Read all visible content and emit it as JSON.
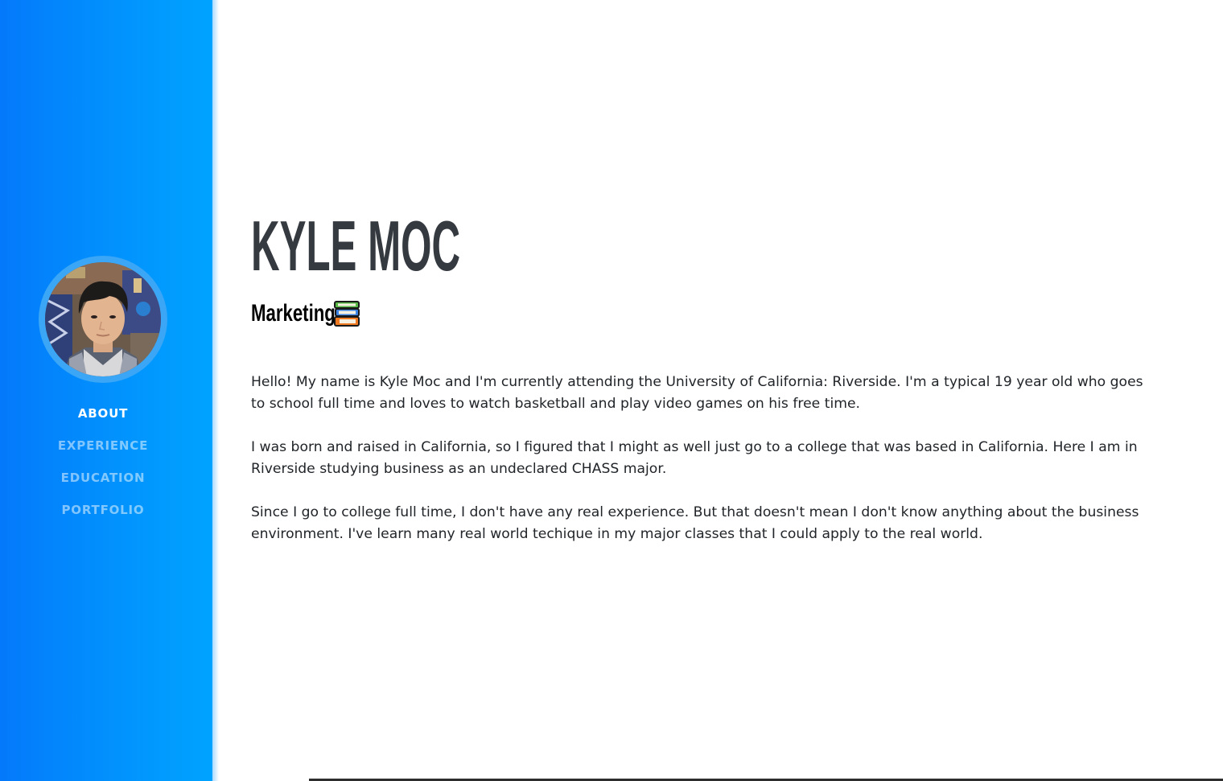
{
  "sidebar": {
    "nav": [
      {
        "label": "ABOUT",
        "active": true
      },
      {
        "label": "EXPERIENCE",
        "active": false
      },
      {
        "label": "EDUCATION",
        "active": false
      },
      {
        "label": "PORTFOLIO",
        "active": false
      }
    ]
  },
  "main": {
    "name": "KYLE MOC",
    "subtitle": "Marketing",
    "subtitle_icon": "books-icon",
    "paragraphs": [
      "Hello! My name is Kyle Moc and I'm currently attending the University of California: Riverside. I'm a typical 19 year old who goes to school full time and loves to watch basketball and play video games on his free time.",
      "I was born and raised in California, so I figured that I might as well just go to a college that was based in California. Here I am in Riverside studying business as an undeclared CHASS major.",
      "Since I go to college full time, I don't have any real experience. But that doesn't mean I don't know anything about the business environment. I've learn many real world techique in my major classes that I could apply to the real world."
    ]
  },
  "colors": {
    "sidebar_gradient_start": "#0479fb",
    "sidebar_gradient_end": "#00a3ff",
    "heading": "#343a40",
    "body_text": "#212529",
    "nav_active": "#ffffff"
  }
}
